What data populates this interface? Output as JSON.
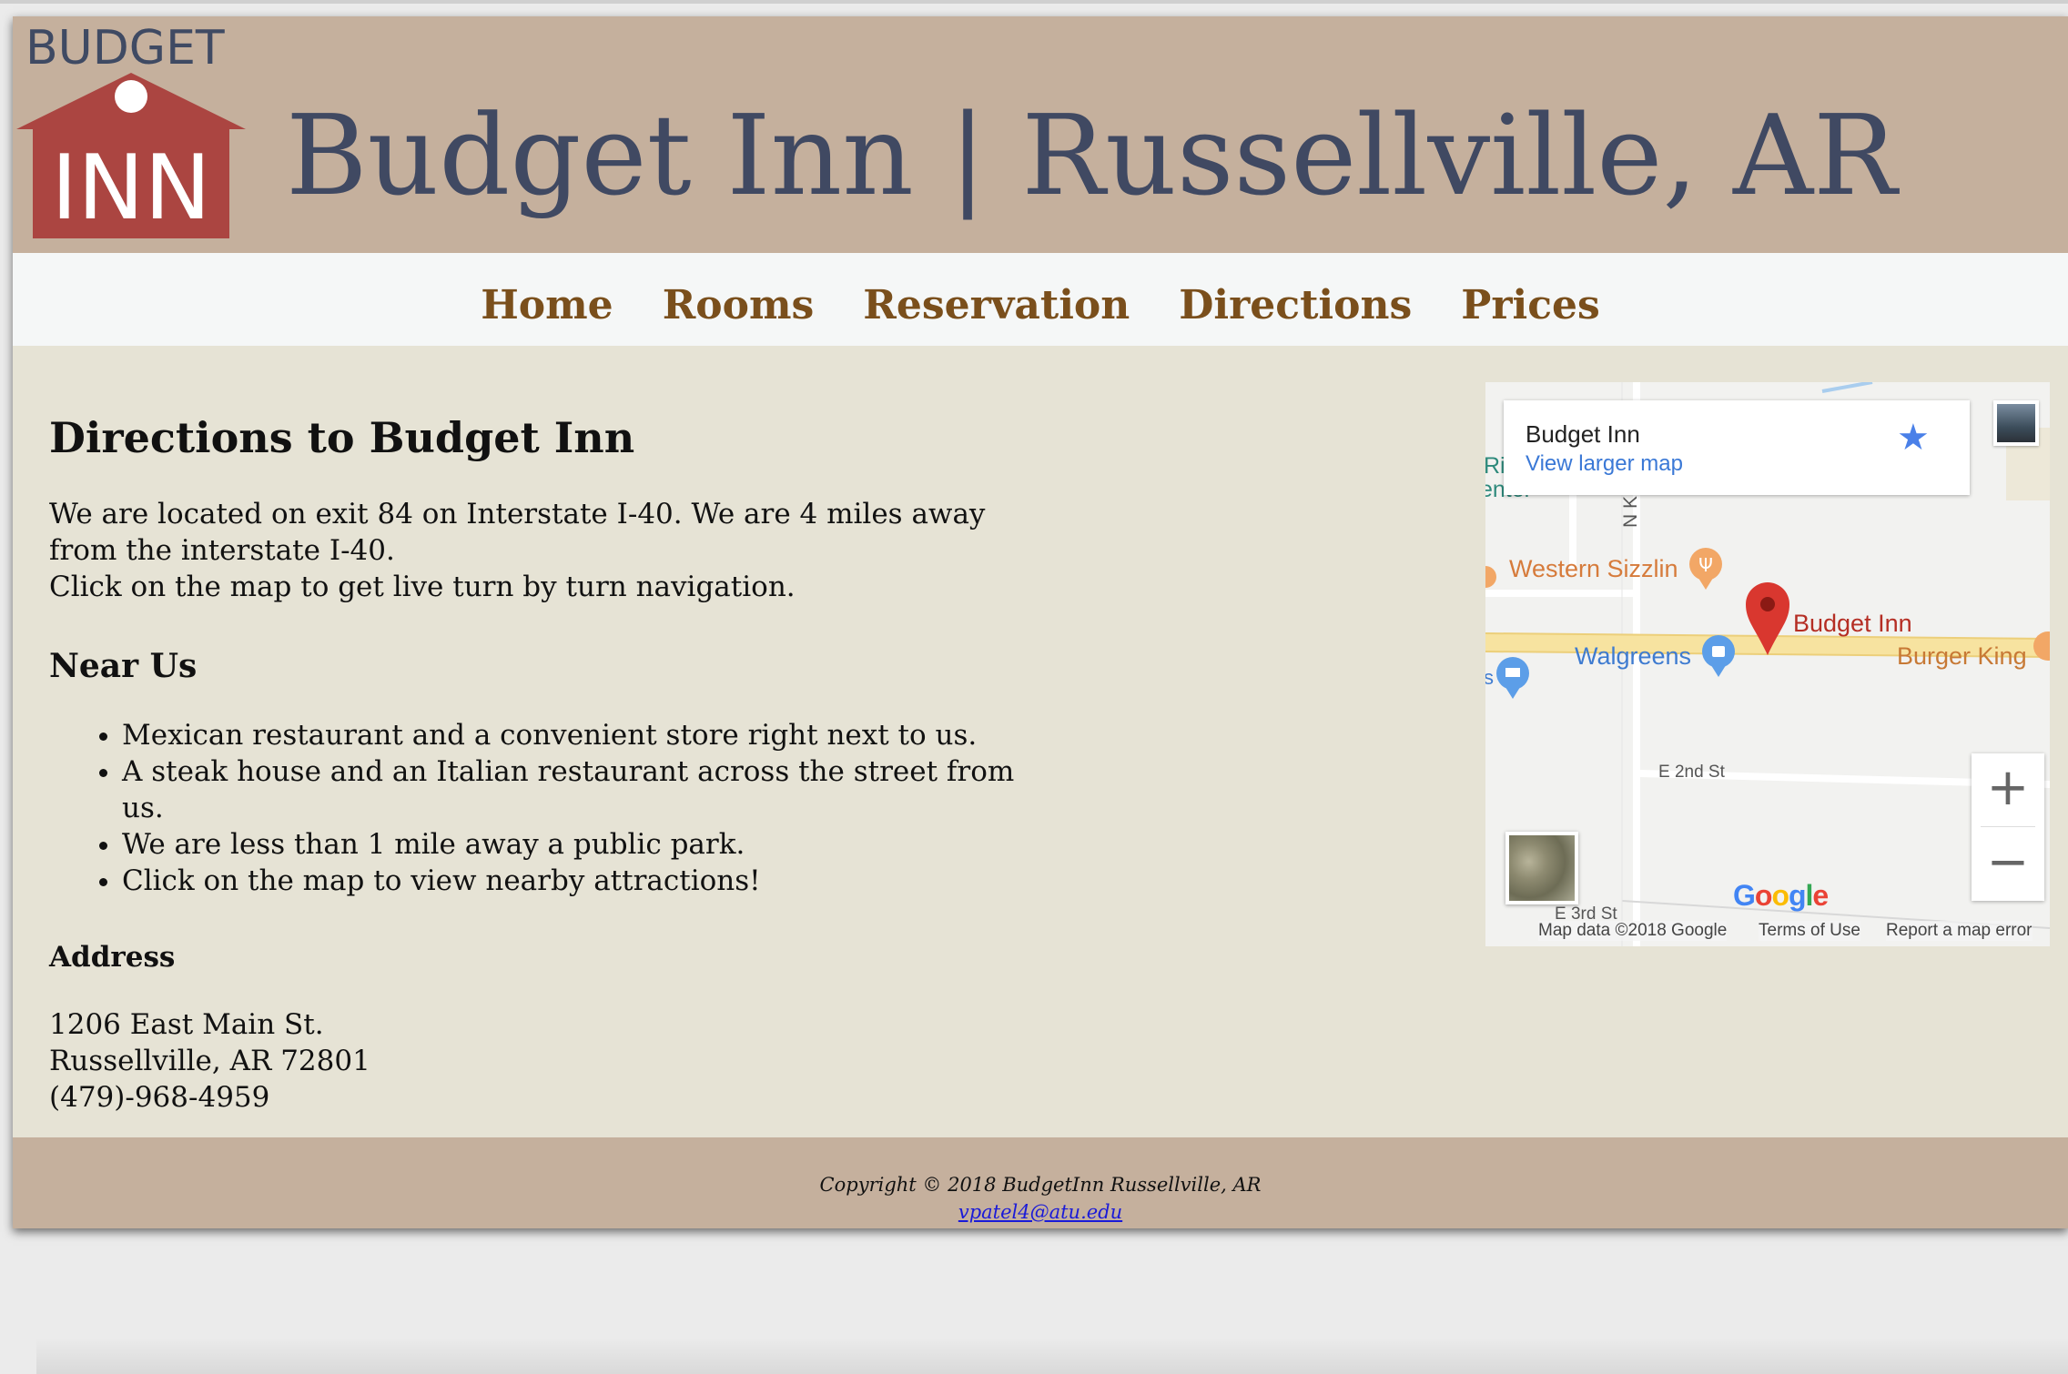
{
  "header": {
    "logo_top": "BUDGET",
    "logo_bottom": "INN",
    "site_title": "Budget Inn | Russellville, AR"
  },
  "nav": {
    "items": [
      {
        "label": "Home"
      },
      {
        "label": "Rooms"
      },
      {
        "label": "Reservation"
      },
      {
        "label": "Directions"
      },
      {
        "label": "Prices"
      }
    ]
  },
  "main": {
    "heading": "Directions to Budget Inn",
    "intro_line1": "We are located on exit 84 on Interstate I-40. We are 4 miles away from the interstate I-40.",
    "intro_line2": "Click on the map to get live turn by turn navigation.",
    "near_heading": "Near Us",
    "near_items": [
      "Mexican restaurant and a convenient store right next to us.",
      "A steak house and an Italian restaurant across the street from us.",
      "We are less than 1 mile away a public park.",
      "Click on the map to view nearby attractions!"
    ],
    "address_heading": "Address",
    "address_street": "1206 East Main St.",
    "address_city": "Russellville, AR 72801",
    "address_phone": "(479)-968-4959"
  },
  "map": {
    "card_name": "Budget Inn",
    "card_link": "View larger map",
    "labels": {
      "western_sizzlin": "Western Sizzlin",
      "budget_inn": "Budget Inn",
      "walgreens": "Walgreens",
      "burger_king": "Burger King",
      "e2nd": "E 2nd St",
      "e3rd": "E 3rd St",
      "n_knoxville": "N Kno",
      "river_center_a": "Riv",
      "river_center_b": "enter",
      "s_left": "s"
    },
    "google": "Google",
    "footer_mapdata": "Map data ©2018 Google",
    "footer_terms": "Terms of Use",
    "footer_report": "Report a map error",
    "colors": {
      "road_major": "#f7e3a0",
      "pin": "#d9372f",
      "food": "#f2a766",
      "shop": "#5c9ee8"
    }
  },
  "footer": {
    "copyright": "Copyright © 2018 BudgetInn Russellville, AR",
    "email": "vpatel4@atu.edu"
  }
}
